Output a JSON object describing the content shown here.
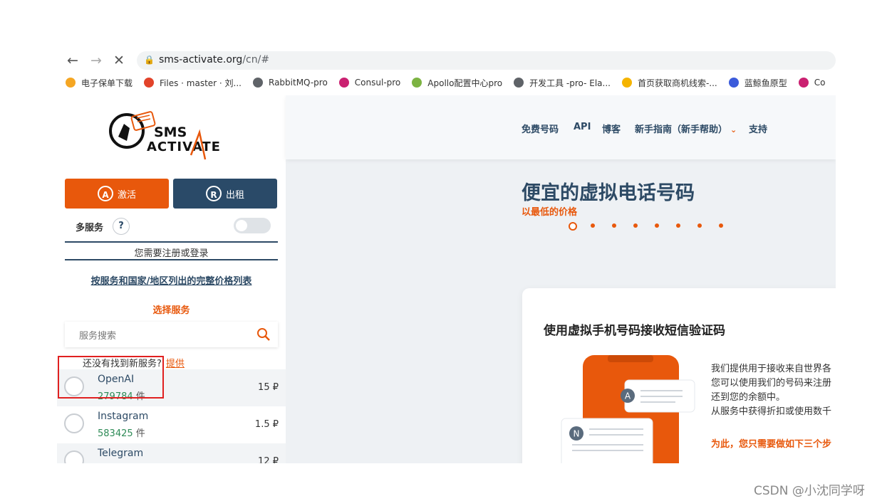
{
  "browser": {
    "url_host": "sms-activate.org",
    "url_path": "/cn/#",
    "bookmarks": [
      {
        "label": "电子保单下载",
        "icon": "person-icon",
        "color": "#f5a623"
      },
      {
        "label": "Files · master · 刘...",
        "icon": "gitlab-icon",
        "color": "#e2432a"
      },
      {
        "label": "RabbitMQ-pro",
        "icon": "globe-icon",
        "color": "#5f6368"
      },
      {
        "label": "Consul-pro",
        "icon": "consul-icon",
        "color": "#ca2171"
      },
      {
        "label": "Apollo配置中心pro",
        "icon": "leaf-icon",
        "color": "#7cb342"
      },
      {
        "label": "开发工具 -pro- Ela...",
        "icon": "globe-icon",
        "color": "#5f6368"
      },
      {
        "label": "首页获取商机线索-...",
        "icon": "tianyancha-icon",
        "color": "#f5b400"
      },
      {
        "label": "蓝鲸鱼原型",
        "icon": "bluewhale-icon",
        "color": "#3b5bdb"
      },
      {
        "label": "Co",
        "icon": "consul-icon",
        "color": "#ca2171"
      }
    ]
  },
  "sidebar": {
    "logo_text_1": "SMS",
    "logo_text_2": "ACTIVATE",
    "activate_label": "激活",
    "rent_label": "出租",
    "multi_service_label": "多服务",
    "help_label": "?",
    "register_text": "您需要注册或登录",
    "price_list_link": "按服务和国家/地区列出的完整价格列表",
    "choose_service": "选择服务",
    "search_placeholder": "服务搜索",
    "not_found_text": "还没有找到新服务?",
    "not_found_link": "提供",
    "services": [
      {
        "name": "OpenAI",
        "count": "279784",
        "unit": "件",
        "price": "15 ₽"
      },
      {
        "name": "Instagram",
        "count": "583425",
        "unit": "件",
        "price": "1.5 ₽"
      },
      {
        "name": "Telegram",
        "count": "",
        "unit": "",
        "price": "12 ₽"
      }
    ]
  },
  "main": {
    "nav": {
      "free_numbers": "免费号码",
      "api": "API",
      "blog": "博客",
      "guide": "新手指南（新手帮助）",
      "support": "支持"
    },
    "hero_title": "便宜的虚拟电话号码",
    "hero_subtitle": "以最低的价格",
    "card_title": "使用虚拟手机号码接收短信验证码",
    "card_lines": [
      "我们提供用于接收来自世界各",
      "您可以使用我们的号码来注册",
      "还到您的余额中。",
      "从服务中获得折扣或使用数千"
    ],
    "card_cta": "为此，您只需要做如下三个步",
    "bubble_a": "A",
    "bubble_n": "N"
  },
  "watermark": "CSDN @小沈同学呀",
  "colors": {
    "accent": "#e8580c",
    "navy": "#2d4a65",
    "green": "#2e8b57"
  }
}
